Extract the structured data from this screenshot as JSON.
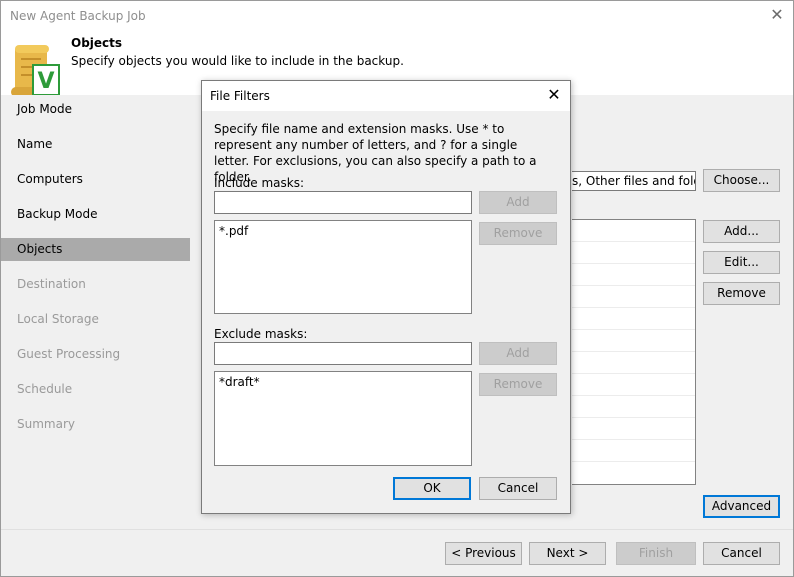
{
  "window": {
    "title": "New Agent Backup Job"
  },
  "header": {
    "title": "Objects",
    "subtitle": "Specify objects you would like to include in the backup."
  },
  "sidebar": {
    "items": [
      {
        "label": "Job Mode",
        "state": "normal"
      },
      {
        "label": "Name",
        "state": "normal"
      },
      {
        "label": "Computers",
        "state": "normal"
      },
      {
        "label": "Backup Mode",
        "state": "normal"
      },
      {
        "label": "Objects",
        "state": "active"
      },
      {
        "label": "Destination",
        "state": "disabled"
      },
      {
        "label": "Local Storage",
        "state": "disabled"
      },
      {
        "label": "Guest Processing",
        "state": "disabled"
      },
      {
        "label": "Schedule",
        "state": "disabled"
      },
      {
        "label": "Summary",
        "state": "disabled"
      }
    ]
  },
  "background": {
    "objects_field_text": "s, Other files and folder",
    "choose_label": "Choose...",
    "add_label": "Add...",
    "edit_label": "Edit...",
    "remove_label": "Remove",
    "advanced_label": "Advanced"
  },
  "footer": {
    "previous_label": "< Previous",
    "next_label": "Next >",
    "finish_label": "Finish",
    "cancel_label": "Cancel"
  },
  "dialog": {
    "title": "File Filters",
    "description": "Specify file name and extension masks. Use * to represent any number of letters, and ? for a single letter. For exclusions, you can also specify a path to a folder.",
    "include_label": "Include masks:",
    "include_input_value": "",
    "include_items": [
      "*.pdf"
    ],
    "include_add_label": "Add",
    "include_remove_label": "Remove",
    "exclude_label": "Exclude masks:",
    "exclude_input_value": "",
    "exclude_items": [
      "*draft*"
    ],
    "exclude_add_label": "Add",
    "exclude_remove_label": "Remove",
    "ok_label": "OK",
    "cancel_label": "Cancel"
  },
  "colors": {
    "accent_focus": "#0078d7",
    "active_nav": "#aaaaaa",
    "panel_bg": "#f0f0f0",
    "scroll_icon_yellow": "#e8b84a",
    "check_green": "#2e9b3a"
  }
}
